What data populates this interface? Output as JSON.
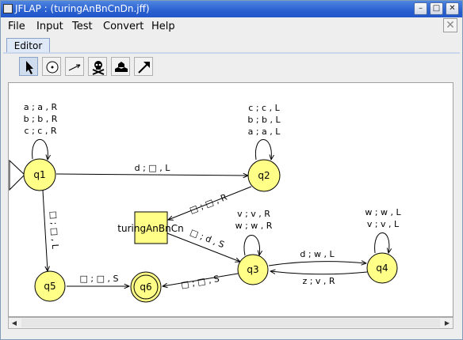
{
  "window": {
    "title": "JFLAP : (turingAnBnCnDn.jff)"
  },
  "menu": [
    "File",
    "Input",
    "Test",
    "Convert",
    "Help"
  ],
  "tabs": [
    {
      "label": "Editor"
    }
  ],
  "toolbar": {
    "tools": [
      "pointer-icon",
      "state-tool-icon",
      "transition-tool-icon",
      "delete-tool-icon",
      "undo-tool-icon",
      "redo-tool-icon"
    ]
  },
  "states": [
    {
      "id": "q1",
      "label": "q1",
      "initial": true,
      "final": false
    },
    {
      "id": "q2",
      "label": "q2",
      "initial": false,
      "final": false
    },
    {
      "id": "q3",
      "label": "q3",
      "initial": false,
      "final": false
    },
    {
      "id": "q4",
      "label": "q4",
      "initial": false,
      "final": false
    },
    {
      "id": "q5",
      "label": "q5",
      "initial": false,
      "final": false
    },
    {
      "id": "q6",
      "label": "q6",
      "initial": false,
      "final": true
    }
  ],
  "block": {
    "label": "turingAnBnCn"
  },
  "transitions": [
    {
      "from": "q1",
      "to": "q1",
      "labels": [
        "a ; a , R",
        "b ; b , R",
        "c ; c , R"
      ]
    },
    {
      "from": "q1",
      "to": "q2",
      "labels": [
        "d ; □ , L"
      ]
    },
    {
      "from": "q2",
      "to": "q2",
      "labels": [
        "c ; c , L",
        "b ; b , L",
        "a ; a , L"
      ]
    },
    {
      "from": "q2",
      "to": "turingAnBnCn",
      "labels": [
        "□ ; □ , R"
      ]
    },
    {
      "from": "q1",
      "to": "q5",
      "labels": [
        "□ ; □ , L"
      ]
    },
    {
      "from": "turingAnBnCn",
      "to": "q3",
      "labels": [
        "□ ; d , S"
      ]
    },
    {
      "from": "q3",
      "to": "q3",
      "labels": [
        "v ; v , R",
        "w ; w , R"
      ]
    },
    {
      "from": "q3",
      "to": "q4",
      "labels": [
        "d ; w , L"
      ]
    },
    {
      "from": "q4",
      "to": "q3",
      "labels": [
        "z ; v , R"
      ]
    },
    {
      "from": "q4",
      "to": "q4",
      "labels": [
        "w ; w , L",
        "v ; v , L"
      ]
    },
    {
      "from": "q3",
      "to": "q6",
      "labels": [
        "□ ; □ , S"
      ]
    },
    {
      "from": "q5",
      "to": "q6",
      "labels": [
        "□ ; □ , S"
      ]
    }
  ]
}
